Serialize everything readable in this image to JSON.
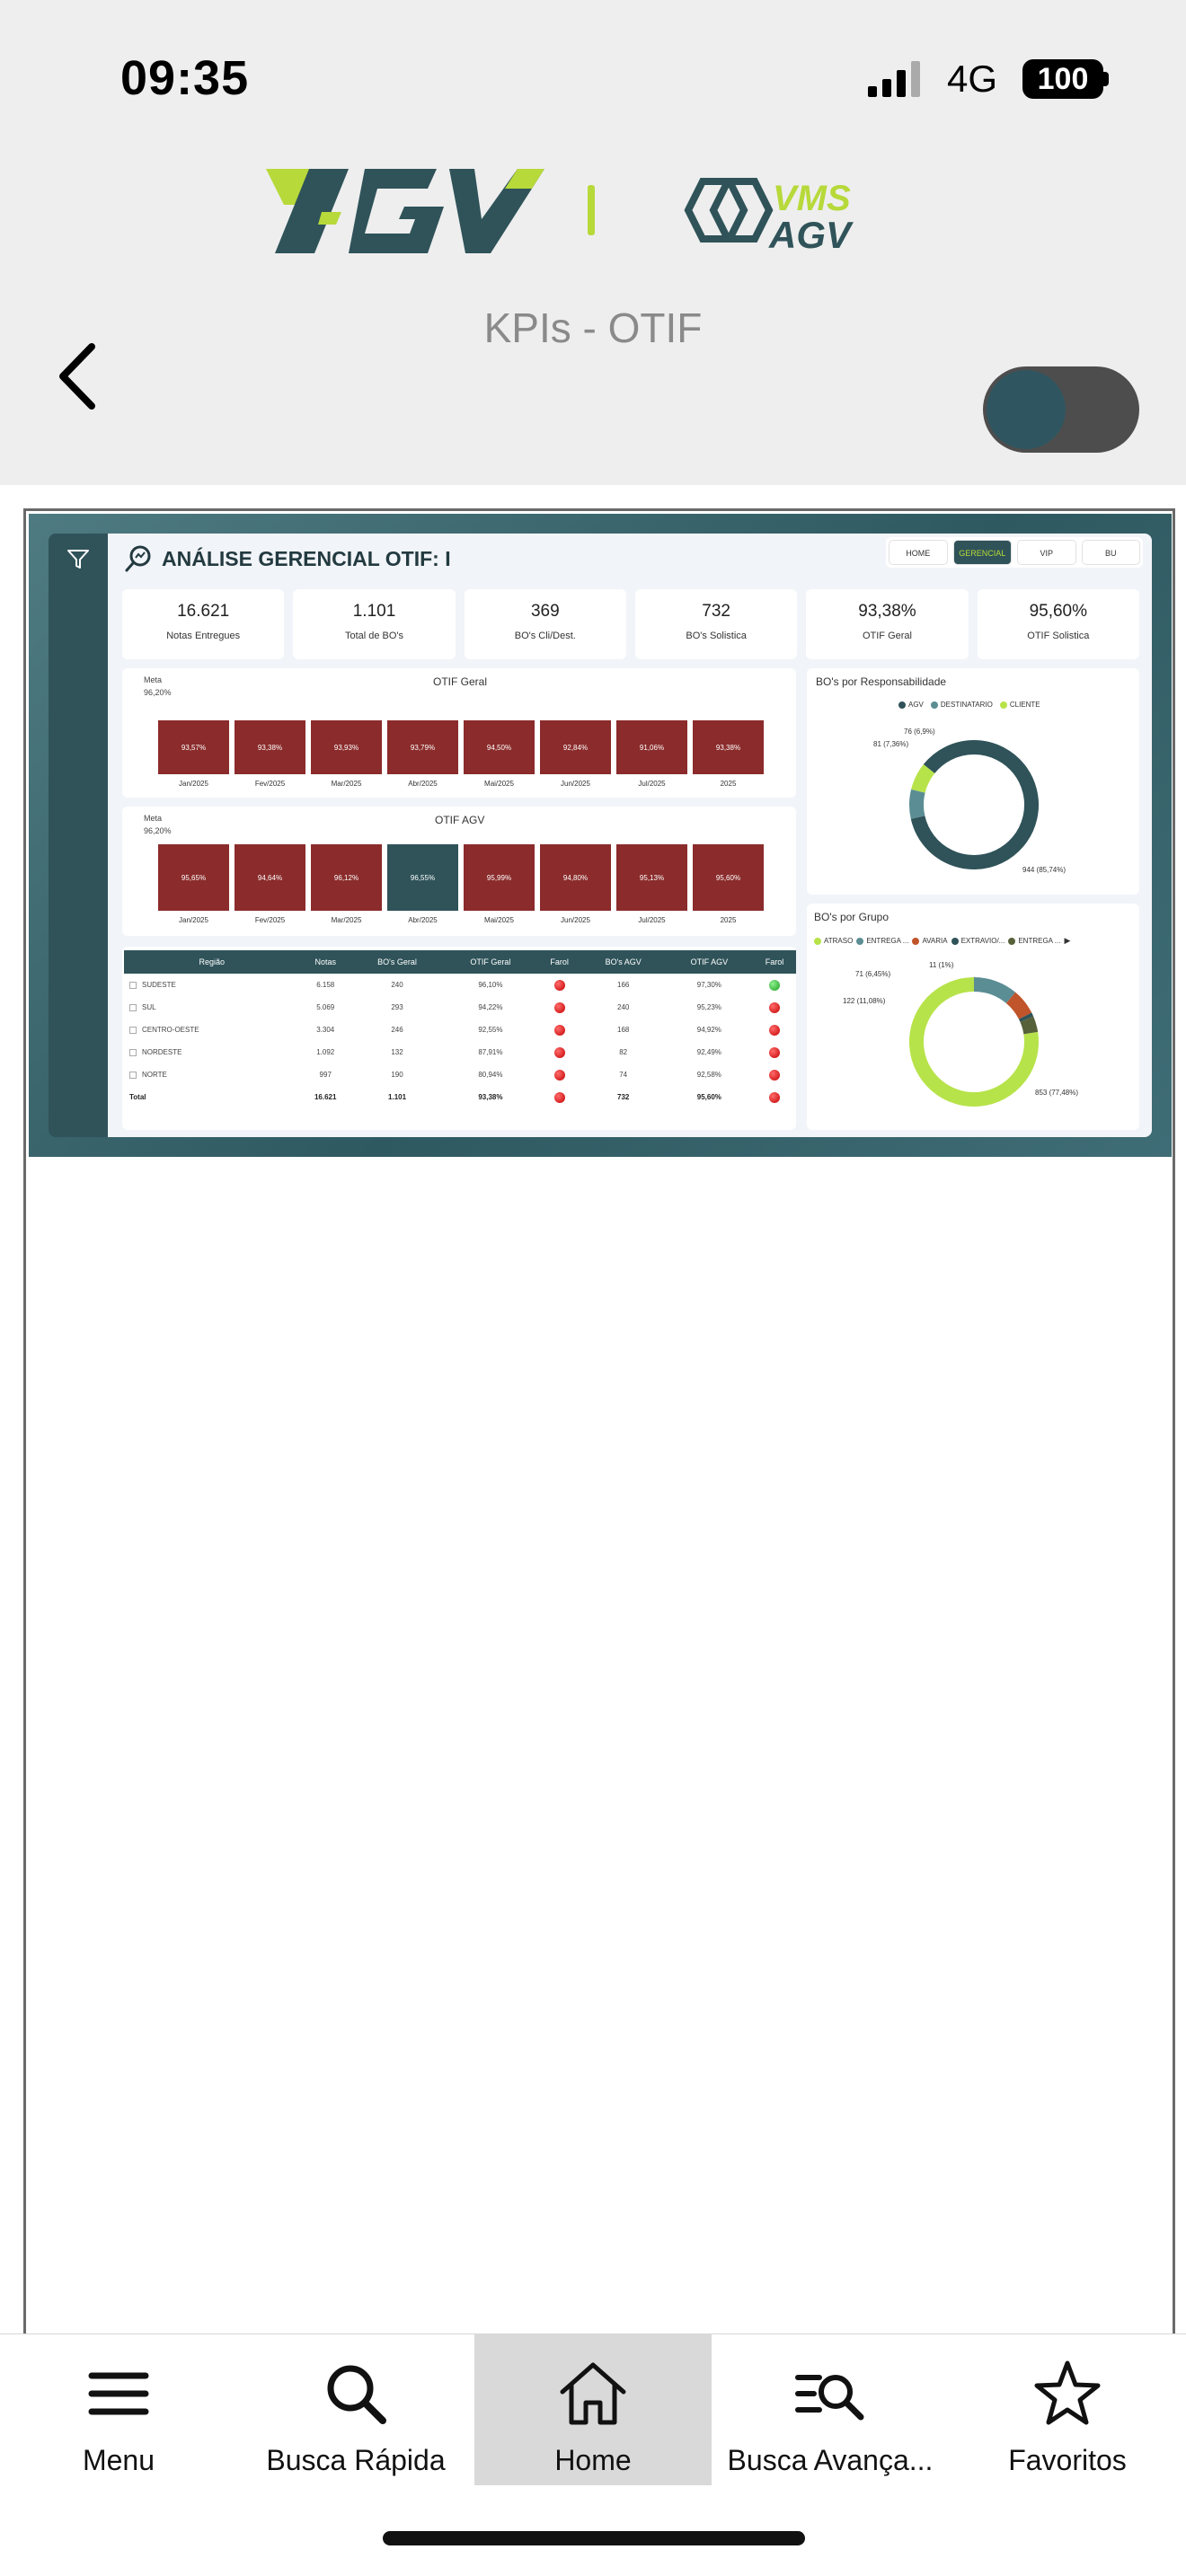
{
  "status_bar": {
    "time": "09:35",
    "network": "4G",
    "battery": "100"
  },
  "header": {
    "title": "KPIs - OTIF",
    "logo_left": "AGV",
    "logo_right_top": "VMS",
    "logo_right_bottom": "AGV"
  },
  "dashboard": {
    "title": "ANÁLISE GERENCIAL OTIF: I",
    "tabs": [
      "HOME",
      "GERENCIAL",
      "VIP",
      "BU"
    ],
    "active_tab": "GERENCIAL",
    "kpis": [
      {
        "value": "16.621",
        "label": "Notas Entregues"
      },
      {
        "value": "1.101",
        "label": "Total de BO's"
      },
      {
        "value": "369",
        "label": "BO's Cli/Dest."
      },
      {
        "value": "732",
        "label": "BO's Solistica"
      },
      {
        "value": "93,38%",
        "label": "OTIF Geral"
      },
      {
        "value": "95,60%",
        "label": "OTIF Solistica"
      }
    ],
    "meta_label": "Meta",
    "meta_value": "96,20%",
    "otif_geral": {
      "title": "OTIF Geral",
      "months": [
        "Jan/2025",
        "Fev/2025",
        "Mar/2025",
        "Abr/2025",
        "Mai/2025",
        "Jun/2025",
        "Jul/2025",
        "2025"
      ],
      "values": [
        "93,57%",
        "93,38%",
        "93,93%",
        "93,79%",
        "94,50%",
        "92,84%",
        "91,06%",
        "93,38%"
      ]
    },
    "otif_agv": {
      "title": "OTIF AGV",
      "months": [
        "Jan/2025",
        "Fev/2025",
        "Mar/2025",
        "Abr/2025",
        "Mai/2025",
        "Jun/2025",
        "Jul/2025",
        "2025"
      ],
      "values": [
        "95,65%",
        "94,64%",
        "96,12%",
        "96,55%",
        "95,99%",
        "94,80%",
        "95,13%",
        "95,60%"
      ],
      "above_target_index": 3
    },
    "table": {
      "headers": [
        "Região",
        "Notas",
        "BO's Geral",
        "OTIF Geral",
        "Farol",
        "BO's AGV",
        "OTIF AGV",
        "Farol"
      ],
      "rows": [
        {
          "regiao": "SUDESTE",
          "notas": "6.158",
          "bos_geral": "240",
          "otif_geral": "96,10%",
          "farol1": "red",
          "bos_agv": "166",
          "otif_agv": "97,30%",
          "farol2": "green"
        },
        {
          "regiao": "SUL",
          "notas": "5.069",
          "bos_geral": "293",
          "otif_geral": "94,22%",
          "farol1": "red",
          "bos_agv": "240",
          "otif_agv": "95,23%",
          "farol2": "red"
        },
        {
          "regiao": "CENTRO-OESTE",
          "notas": "3.304",
          "bos_geral": "246",
          "otif_geral": "92,55%",
          "farol1": "red",
          "bos_agv": "168",
          "otif_agv": "94,92%",
          "farol2": "red"
        },
        {
          "regiao": "NORDESTE",
          "notas": "1.092",
          "bos_geral": "132",
          "otif_geral": "87,91%",
          "farol1": "red",
          "bos_agv": "82",
          "otif_agv": "92,49%",
          "farol2": "red"
        },
        {
          "regiao": "NORTE",
          "notas": "997",
          "bos_geral": "190",
          "otif_geral": "80,94%",
          "farol1": "red",
          "bos_agv": "74",
          "otif_agv": "92,58%",
          "farol2": "red"
        }
      ],
      "total": {
        "regiao": "Total",
        "notas": "16.621",
        "bos_geral": "1.101",
        "otif_geral": "93,38%",
        "farol1": "red",
        "bos_agv": "732",
        "otif_agv": "95,60%",
        "farol2": "red"
      }
    },
    "bos_responsabilidade": {
      "title": "BO's por Responsabilidade",
      "legend": [
        "AGV",
        "DESTINATARIO",
        "CLIENTE"
      ],
      "labels": [
        "76 (6,9%)",
        "81 (7,36%)",
        "944 (85,74%)"
      ],
      "values": [
        944,
        81,
        76
      ],
      "colors": [
        "#2f5359",
        "#5b8d94",
        "#b7e34a"
      ]
    },
    "bos_grupo": {
      "title": "BO's por Grupo",
      "legend": [
        "ATRASO",
        "ENTREGA ...",
        "AVARIA",
        "EXTRAVIO/...",
        "ENTREGA ..."
      ],
      "labels": [
        "11 (1%)",
        "71 (6,45%)",
        "122 (11,08%)",
        "853 (77,48%)"
      ],
      "values": [
        853,
        122,
        71,
        11,
        44
      ],
      "colors": [
        "#b7e34a",
        "#5b8d94",
        "#c0542a",
        "#2f5359",
        "#56613a"
      ]
    }
  },
  "bottom_nav": [
    {
      "label": "Menu",
      "icon": "menu-icon"
    },
    {
      "label": "Busca Rápida",
      "icon": "search-icon"
    },
    {
      "label": "Home",
      "icon": "home-icon"
    },
    {
      "label": "Busca Avança...",
      "icon": "advanced-search-icon"
    },
    {
      "label": "Favoritos",
      "icon": "star-icon"
    }
  ],
  "active_nav": "Home"
}
